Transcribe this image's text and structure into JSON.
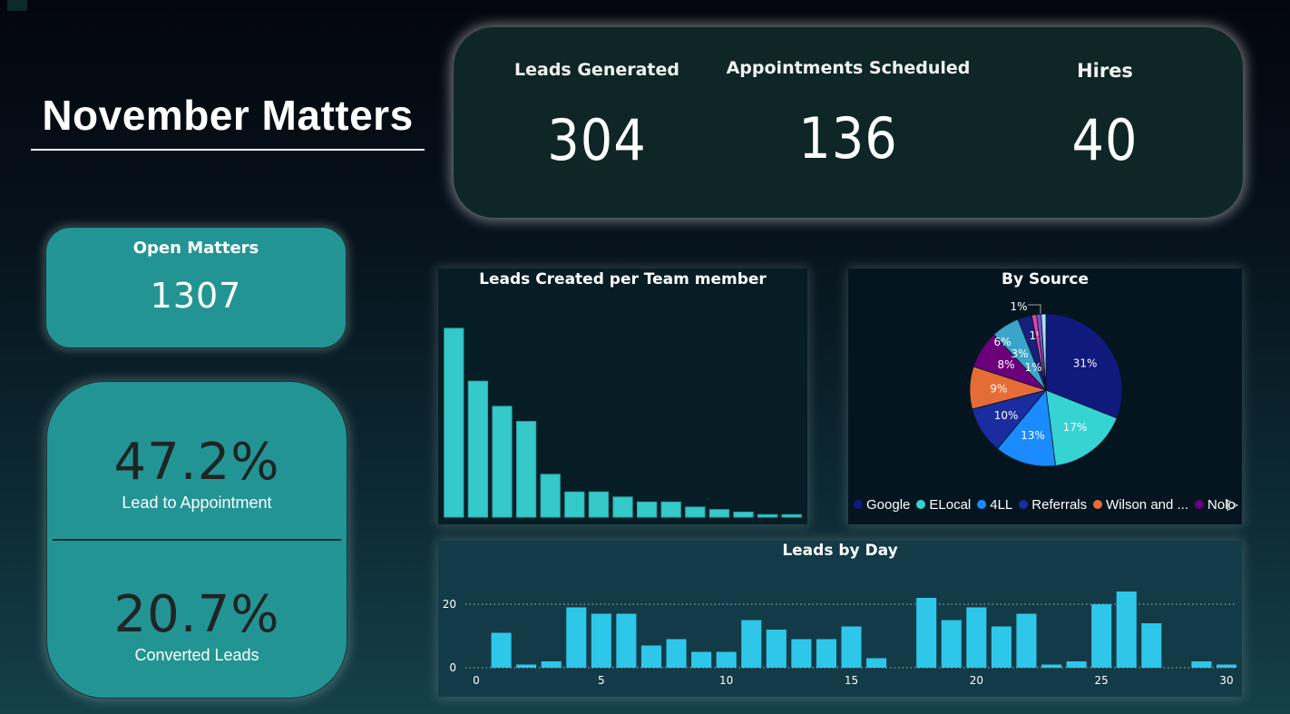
{
  "dashboard": {
    "title": "November Matters"
  },
  "kpis": [
    {
      "label": "Leads Generated",
      "value": "304"
    },
    {
      "label": "Appointments Scheduled",
      "value": "136"
    },
    {
      "label": "Hires",
      "value": "40"
    }
  ],
  "open_matters": {
    "label": "Open Matters",
    "value": "1307"
  },
  "ratios": {
    "lead_to_appointment": {
      "value": "47.2%",
      "label": "Lead to Appointment"
    },
    "converted_leads": {
      "value": "20.7%",
      "label": "Converted Leads"
    }
  },
  "colors": {
    "teal_card": "#239494",
    "bar_team": "#36c9c9",
    "bar_day": "#2ec7ea"
  },
  "legend_more_icon": "chevron-right-icon",
  "chart_data": [
    {
      "type": "bar",
      "title": "Leads Created per Team member",
      "values": [
        75,
        54,
        44,
        38,
        17,
        10,
        10,
        8,
        6,
        6,
        4,
        3,
        2,
        1,
        1
      ],
      "ylim": [
        0,
        80
      ],
      "axes_visible": false
    },
    {
      "type": "pie",
      "title": "By Source",
      "slices": [
        {
          "name": "Google",
          "value": 31,
          "label": "31%",
          "color": "#10197c"
        },
        {
          "name": "ELocal",
          "value": 17,
          "label": "17%",
          "color": "#36d3d3"
        },
        {
          "name": "4LL",
          "value": 13,
          "label": "13%",
          "color": "#1a8cff"
        },
        {
          "name": "Referrals",
          "value": 10,
          "label": "10%",
          "color": "#1a2c9e"
        },
        {
          "name": "Wilson and ...",
          "value": 9,
          "label": "9%",
          "color": "#e66c37"
        },
        {
          "name": "Nolo",
          "value": 8,
          "label": "8%",
          "color": "#6b007b"
        },
        {
          "name": "",
          "value": 6,
          "label": "6%",
          "color": "#3aa5c8"
        },
        {
          "name": "",
          "value": 3,
          "label": "3%",
          "color": "#17207a"
        },
        {
          "name": "",
          "value": 1,
          "label": "1%",
          "color": "#e044a7"
        },
        {
          "name": "",
          "value": 1,
          "label": "1%",
          "color": "#744ec2"
        },
        {
          "name": "",
          "value": 1,
          "label": "1%",
          "color": "#a8e3ff"
        }
      ],
      "legend": [
        "Google",
        "ELocal",
        "4LL",
        "Referrals",
        "Wilson and ...",
        "Nolo"
      ],
      "legend_position": "bottom"
    },
    {
      "type": "bar",
      "title": "Leads by Day",
      "x": [
        0,
        1,
        2,
        3,
        4,
        5,
        6,
        7,
        8,
        9,
        10,
        11,
        12,
        13,
        14,
        15,
        16,
        17,
        18,
        19,
        20,
        21,
        22,
        23,
        24,
        25,
        26,
        27,
        28,
        29,
        30
      ],
      "values": [
        0,
        11,
        1,
        2,
        19,
        17,
        17,
        7,
        9,
        5,
        5,
        15,
        12,
        9,
        9,
        13,
        3,
        0,
        22,
        15,
        19,
        13,
        17,
        1,
        2,
        20,
        24,
        14,
        0,
        2,
        1
      ],
      "x_ticks": [
        0,
        5,
        10,
        15,
        20,
        25,
        30
      ],
      "y_ticks": [
        0,
        20
      ],
      "ylim": [
        0,
        26
      ],
      "grid": "dotted-horizontal"
    }
  ]
}
